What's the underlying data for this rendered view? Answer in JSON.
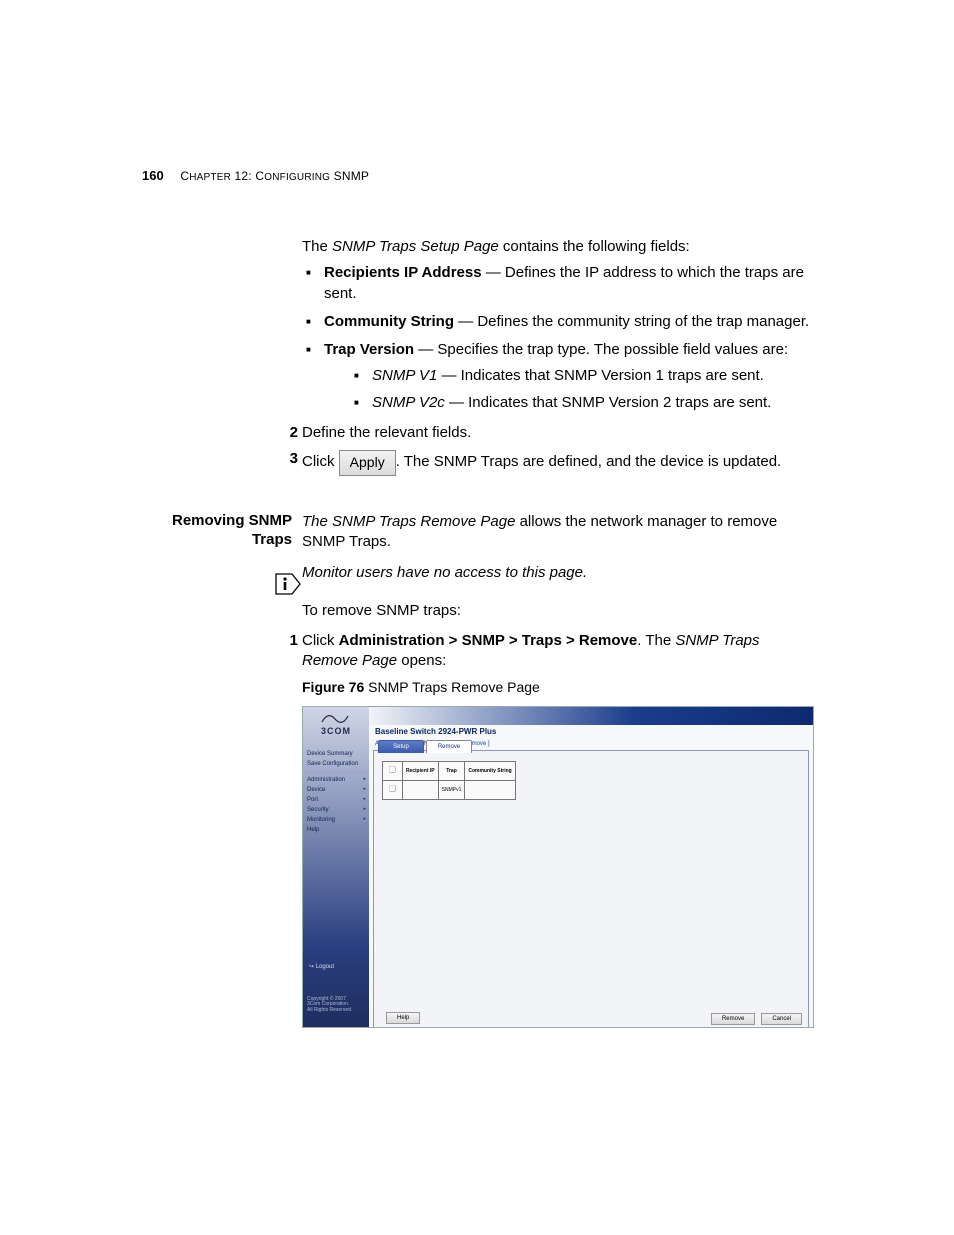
{
  "header": {
    "page_number": "160",
    "chapter_small_a": "C",
    "chapter_small_b": "HAPTER",
    "chapter_rest": " 12: C",
    "onfig": "ONFIGURING",
    "snmp": " SNMP"
  },
  "p1": {
    "pre": "The ",
    "ital": "SNMP Traps Setup Page",
    "post": " contains the following fields:"
  },
  "b1": {
    "bold": "Recipients IP Address",
    "rest": " — Defines the IP address to which the traps are sent."
  },
  "b2": {
    "bold": "Community String",
    "rest": " — Defines the community string of the trap manager."
  },
  "b3": {
    "bold": "Trap Version",
    "rest": " — Specifies the trap type. The possible field values are:"
  },
  "b3a": {
    "ital": "SNMP V1",
    "rest": " — Indicates that SNMP Version 1 traps are sent."
  },
  "b3b": {
    "ital": "SNMP V2c",
    "rest": " — Indicates that SNMP Version 2 traps are sent."
  },
  "step2": {
    "num": "2",
    "text": "Define the relevant fields."
  },
  "step3": {
    "num": "3",
    "pre": "Click ",
    "btn": "Apply",
    "post": ". The SNMP Traps are defined, and the device is updated."
  },
  "sec": {
    "heading_a": "Removing SNMP",
    "heading_b": "Traps"
  },
  "sec_p1": {
    "ital": "The SNMP Traps Remove Page",
    "post": " allows the network manager to remove SNMP Traps."
  },
  "sec_monitor": "Monitor users have no access to this page.",
  "sec_to": "To remove SNMP traps:",
  "sec_step1": {
    "num": "1",
    "pre": "Click ",
    "bold": "Administration > SNMP > Traps > Remove",
    "post1": ". The ",
    "ital": "SNMP Traps Remove Page",
    "post2": " opens:"
  },
  "fig": {
    "label": "Figure 76",
    "cap": "   SNMP Traps Remove Page"
  },
  "shot": {
    "logo": "3COM",
    "side_items": [
      "Device Summary",
      "Save Configuration",
      "Administration",
      "Device",
      "Port",
      "Security",
      "Monitoring",
      "Help"
    ],
    "logout_icon": "↪",
    "logout": "Logout",
    "copy": "Copyright © 2007\n3Com Corporation.\nAll Rights Reserved.",
    "title": "Baseline Switch 2924-PWR Plus",
    "bc_pre": "Administration > SNMP > Traps ",
    "bc_cur": "[ Remove ]",
    "tabs": {
      "setup": "Setup",
      "remove": "Remove"
    },
    "tbl": {
      "h1": "",
      "h2": "Recipient IP",
      "h3": "Trap",
      "h4": "Community String",
      "r1c3": "SNMPv1"
    },
    "help": "Help",
    "remove_btn": "Remove",
    "cancel": "Cancel"
  }
}
